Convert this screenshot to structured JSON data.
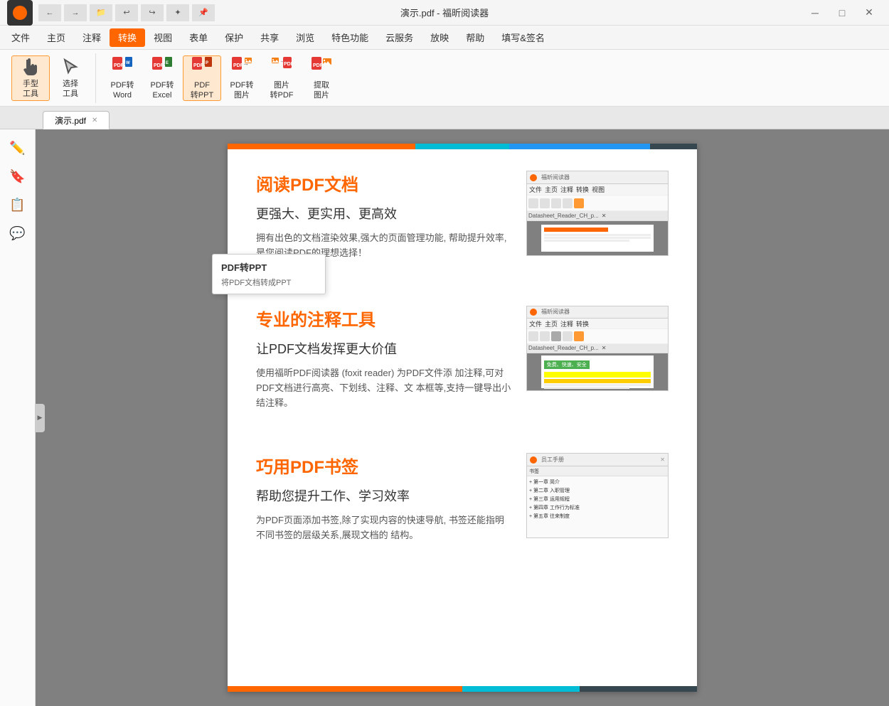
{
  "titlebar": {
    "title": "演示.pdf - 福昕阅读器",
    "controls": {
      "minimize": "─",
      "maximize": "□",
      "close": "✕"
    }
  },
  "menubar": {
    "items": [
      {
        "label": "文件",
        "active": false
      },
      {
        "label": "主页",
        "active": false
      },
      {
        "label": "注释",
        "active": false
      },
      {
        "label": "转换",
        "active": true
      },
      {
        "label": "视图",
        "active": false
      },
      {
        "label": "表单",
        "active": false
      },
      {
        "label": "保护",
        "active": false
      },
      {
        "label": "共享",
        "active": false
      },
      {
        "label": "浏览",
        "active": false
      },
      {
        "label": "特色功能",
        "active": false
      },
      {
        "label": "云服务",
        "active": false
      },
      {
        "label": "放映",
        "active": false
      },
      {
        "label": "帮助",
        "active": false
      },
      {
        "label": "填写&签名",
        "active": false
      }
    ]
  },
  "toolbar": {
    "groups": [
      {
        "tools": [
          {
            "id": "hand-tool",
            "label": "手型\n工具",
            "active": true
          },
          {
            "id": "select-tool",
            "label": "选择\n工具",
            "active": false
          }
        ]
      },
      {
        "tools": [
          {
            "id": "pdf-to-word",
            "label": "PDF转\nWord",
            "active": false
          },
          {
            "id": "pdf-to-excel",
            "label": "PDF转\nExcel",
            "active": false
          },
          {
            "id": "pdf-to-ppt",
            "label": "PDF\n转PPT",
            "active": true
          },
          {
            "id": "pdf-to-image",
            "label": "PDF转\n图片",
            "active": false
          },
          {
            "id": "image-to-pdf",
            "label": "图片\n转PDF",
            "active": false
          },
          {
            "id": "extract-image",
            "label": "提取\n图片",
            "active": false
          }
        ]
      }
    ]
  },
  "tab": {
    "filename": "演示.pdf"
  },
  "tooltip": {
    "title": "PDF转PPT",
    "description": "将PDF文档转成PPT"
  },
  "pdf": {
    "section1": {
      "title": "阅读PDF文档",
      "subtitle": "更强大、更实用、更高效",
      "text": "拥有出色的文档渲染效果,强大的页面管理功能,\n帮助提升效率,是您阅读PDF的理想选择！"
    },
    "section2": {
      "title": "专业的注释工具",
      "subtitle": "让PDF文档发挥更大价值",
      "text": "使用福昕PDF阅读器 (foxit reader) 为PDF文件添\n加注释,可对PDF文档进行高亮、下划线、注释、文\n本框等,支持一键导出小结注释。",
      "badge": "免费、快速、安全"
    },
    "section3": {
      "title": "巧用PDF书签",
      "subtitle": "帮助您提升工作、学习效率",
      "text": "为PDF页面添加书签,除了实现内容的快速导航,\n书签还能指明不同书签的层级关系,展现文档的\n结构。"
    }
  },
  "sidebar": {
    "icons": [
      "✏",
      "🔖",
      "📋",
      "💬"
    ]
  }
}
